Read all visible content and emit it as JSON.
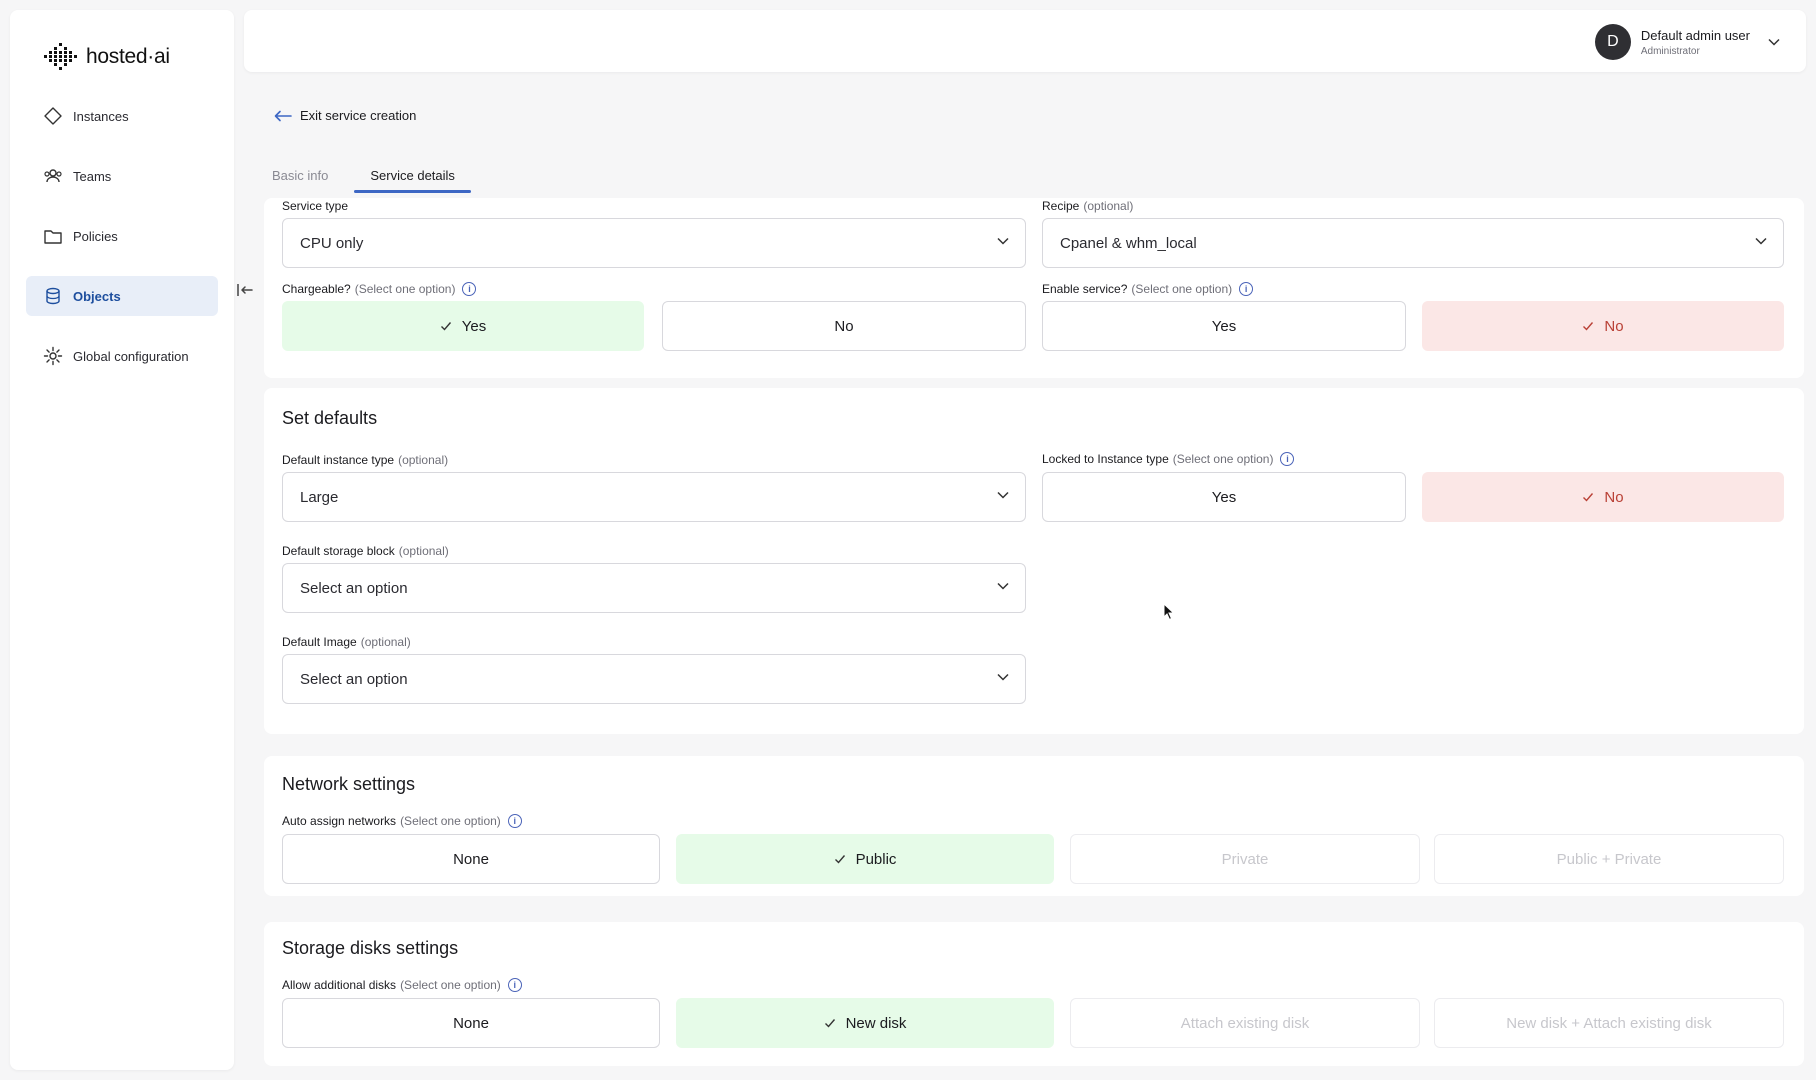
{
  "app": {
    "logo_text": "hosted·ai"
  },
  "sidebar": {
    "items": [
      {
        "label": "Instances",
        "icon": "diamond-icon"
      },
      {
        "label": "Teams",
        "icon": "users-icon"
      },
      {
        "label": "Policies",
        "icon": "folder-icon"
      },
      {
        "label": "Objects",
        "icon": "cylinder-icon",
        "active": true
      },
      {
        "label": "Global configuration",
        "icon": "gear-icon"
      }
    ]
  },
  "header": {
    "avatar_letter": "D",
    "user_name": "Default admin user",
    "user_role": "Administrator"
  },
  "nav": {
    "exit_label": "Exit service creation"
  },
  "tabs": [
    {
      "label": "Basic info",
      "active": false
    },
    {
      "label": "Service details",
      "active": true
    }
  ],
  "service": {
    "service_type_label": "Service type",
    "service_type_value": "CPU only",
    "recipe_label": "Recipe",
    "optional": "(optional)",
    "recipe_value": "Cpanel & whm_local",
    "chargeable_label": "Chargeable?",
    "select_one": "(Select one option)",
    "chargeable_yes": "Yes",
    "chargeable_no": "No",
    "enable_label": "Enable service?",
    "enable_yes": "Yes",
    "enable_no": "No"
  },
  "defaults": {
    "title": "Set defaults",
    "instance_type_label": "Default instance type",
    "instance_type_value": "Large",
    "locked_label": "Locked to Instance type",
    "locked_yes": "Yes",
    "locked_no": "No",
    "storage_label": "Default storage block",
    "storage_value": "Select an option",
    "image_label": "Default Image",
    "image_value": "Select an option"
  },
  "network": {
    "title": "Network settings",
    "auto_label": "Auto assign networks",
    "options": [
      "None",
      "Public",
      "Private",
      "Public + Private"
    ]
  },
  "storage": {
    "title": "Storage disks settings",
    "allow_label": "Allow additional disks",
    "options": [
      "None",
      "New disk",
      "Attach existing disk",
      "New disk + Attach existing disk"
    ]
  },
  "colors": {
    "accent": "#3d67c4",
    "selected_green": "#e6fbe8",
    "selected_red": "#fbe7e6"
  }
}
